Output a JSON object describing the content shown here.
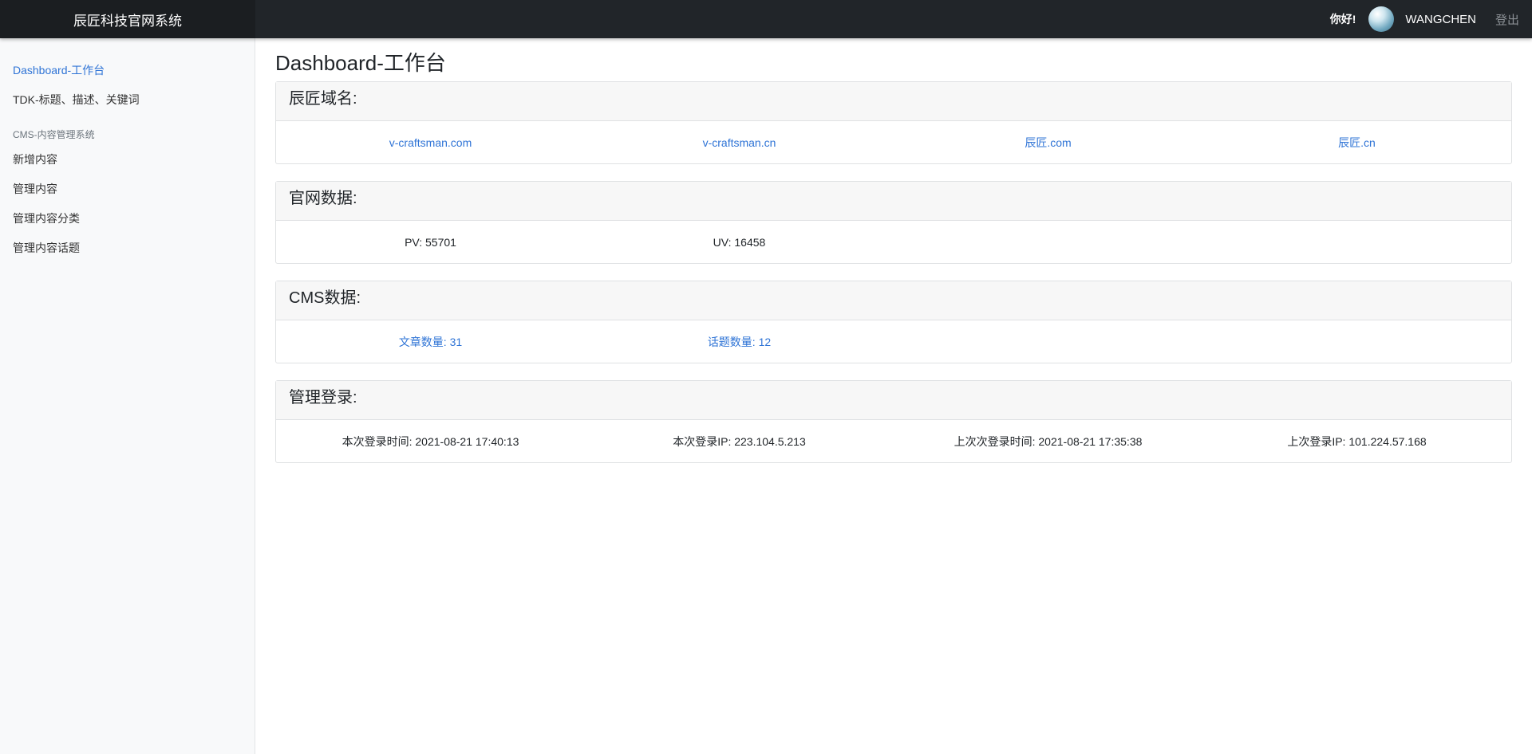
{
  "header": {
    "brand": "辰匠科技官网系统",
    "greeting": "你好!",
    "username": "WANGCHEN",
    "logout": "登出"
  },
  "sidebar": {
    "items": [
      {
        "label": "Dashboard-工作台",
        "active": true
      },
      {
        "label": "TDK-标题、描述、关键词",
        "active": false
      }
    ],
    "section_heading": "CMS-内容管理系统",
    "section_items": [
      {
        "label": "新增内容"
      },
      {
        "label": "管理内容"
      },
      {
        "label": "管理内容分类"
      },
      {
        "label": "管理内容话题"
      }
    ]
  },
  "main": {
    "title": "Dashboard-工作台",
    "cards": {
      "domains": {
        "title": "辰匠域名:",
        "items": [
          "v-craftsman.com",
          "v-craftsman.cn",
          "辰匠.com",
          "辰匠.cn"
        ]
      },
      "site_data": {
        "title": "官网数据:",
        "pv": "PV: 55701",
        "uv": "UV: 16458"
      },
      "cms_data": {
        "title": "CMS数据:",
        "articles": "文章数量: 31",
        "topics": "话题数量: 12"
      },
      "login": {
        "title": "管理登录:",
        "current_time": "本次登录时间: 2021-08-21 17:40:13",
        "current_ip": "本次登录IP: 223.104.5.213",
        "last_time": "上次次登录时间: 2021-08-21 17:35:38",
        "last_ip": "上次登录IP: 101.224.57.168"
      }
    }
  },
  "colors": {
    "topbar": "#212529",
    "link": "#2f74d6",
    "sidebar_bg": "#f8f9fa"
  }
}
